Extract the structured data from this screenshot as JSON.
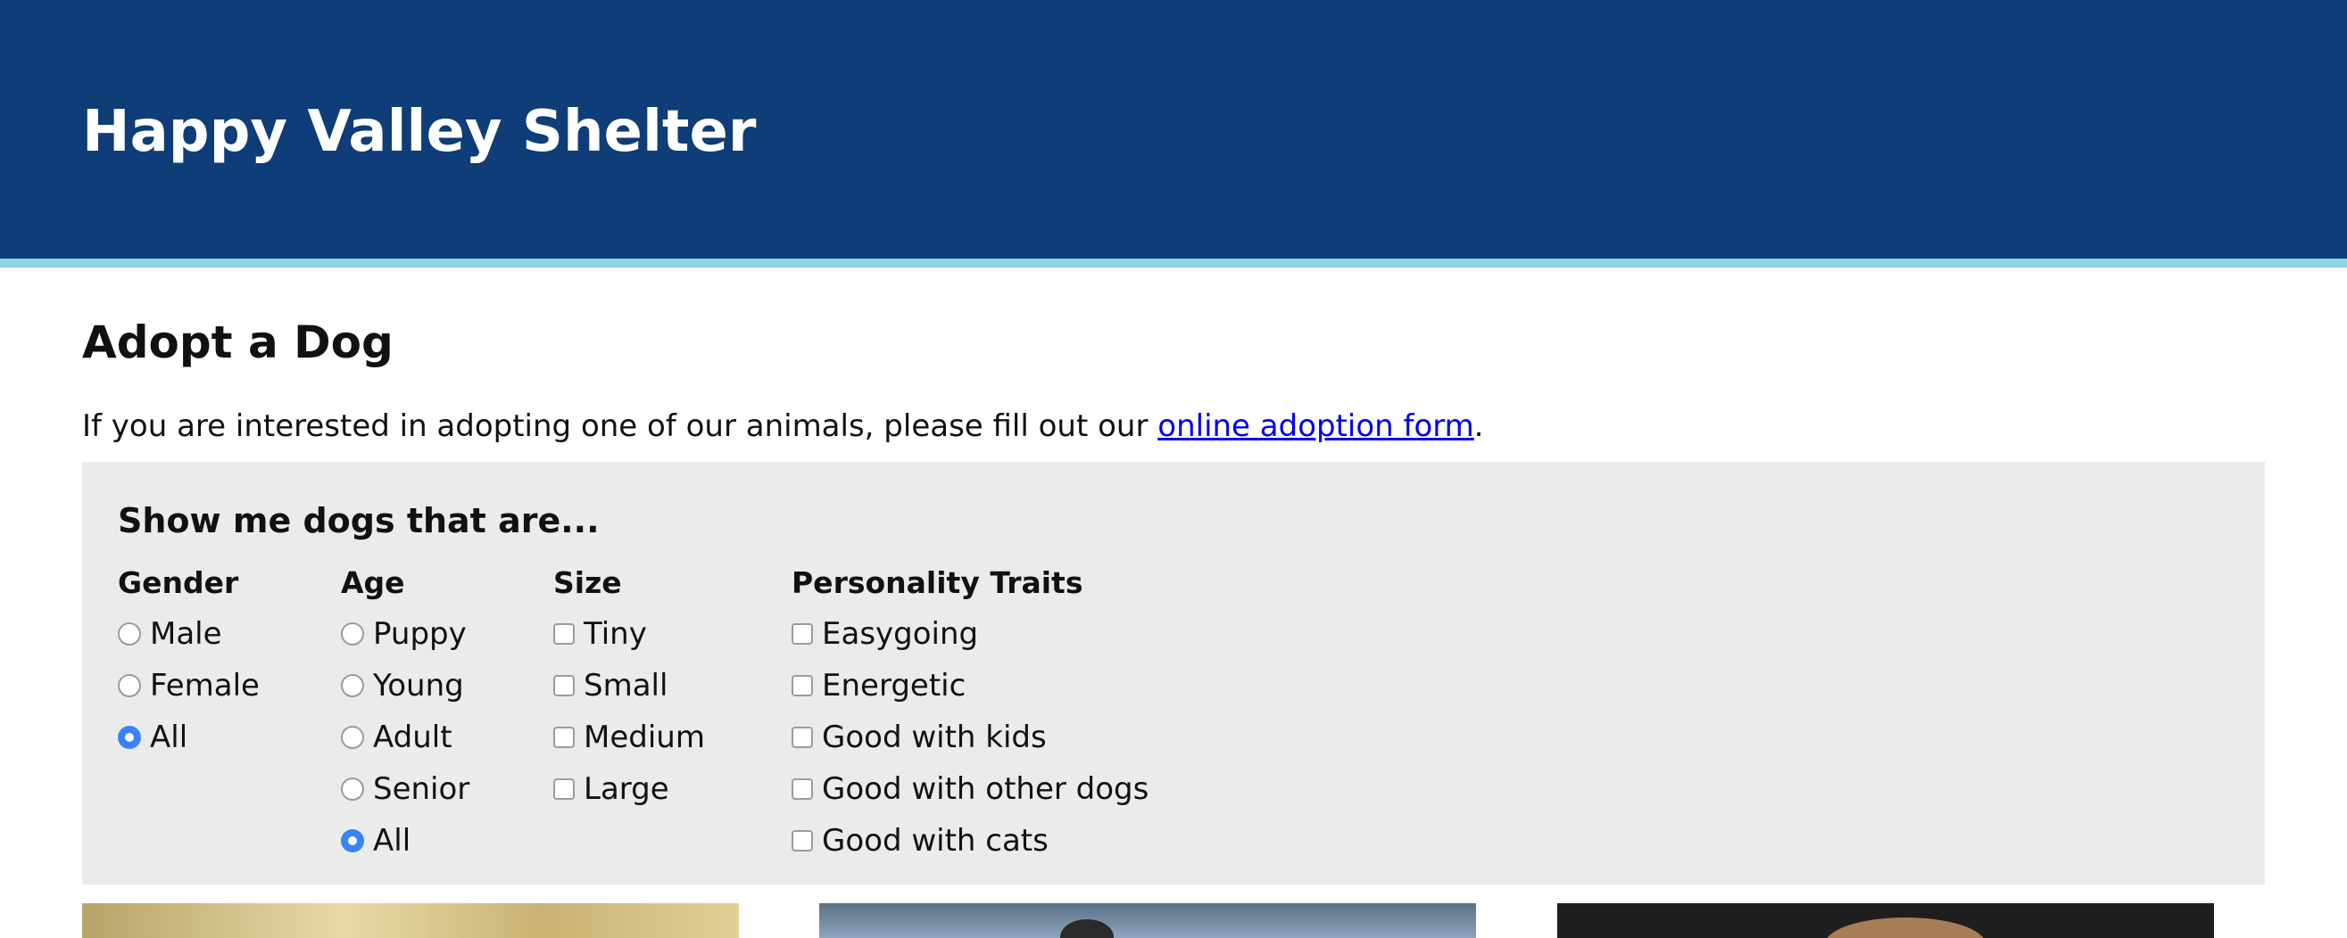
{
  "header": {
    "site_title": "Happy Valley Shelter",
    "background_color": "#0e3d77",
    "accent_border_color": "#8fd3e4"
  },
  "main": {
    "heading": "Adopt a Dog",
    "intro": {
      "before_link": "If you are interested in adopting one of our animals, please fill out our ",
      "link_text": "online adoption form",
      "after_link": "."
    }
  },
  "filters": {
    "heading": "Show me dogs that are...",
    "groups": {
      "gender": {
        "label": "Gender",
        "type": "radio",
        "options": [
          "Male",
          "Female",
          "All"
        ],
        "selected": "All"
      },
      "age": {
        "label": "Age",
        "type": "radio",
        "options": [
          "Puppy",
          "Young",
          "Adult",
          "Senior",
          "All"
        ],
        "selected": "All"
      },
      "size": {
        "label": "Size",
        "type": "checkbox",
        "options": [
          "Tiny",
          "Small",
          "Medium",
          "Large"
        ]
      },
      "personality": {
        "label": "Personality Traits",
        "type": "checkbox",
        "options": [
          "Easygoing",
          "Energetic",
          "Good with kids",
          "Good with other dogs",
          "Good with cats"
        ]
      }
    }
  }
}
